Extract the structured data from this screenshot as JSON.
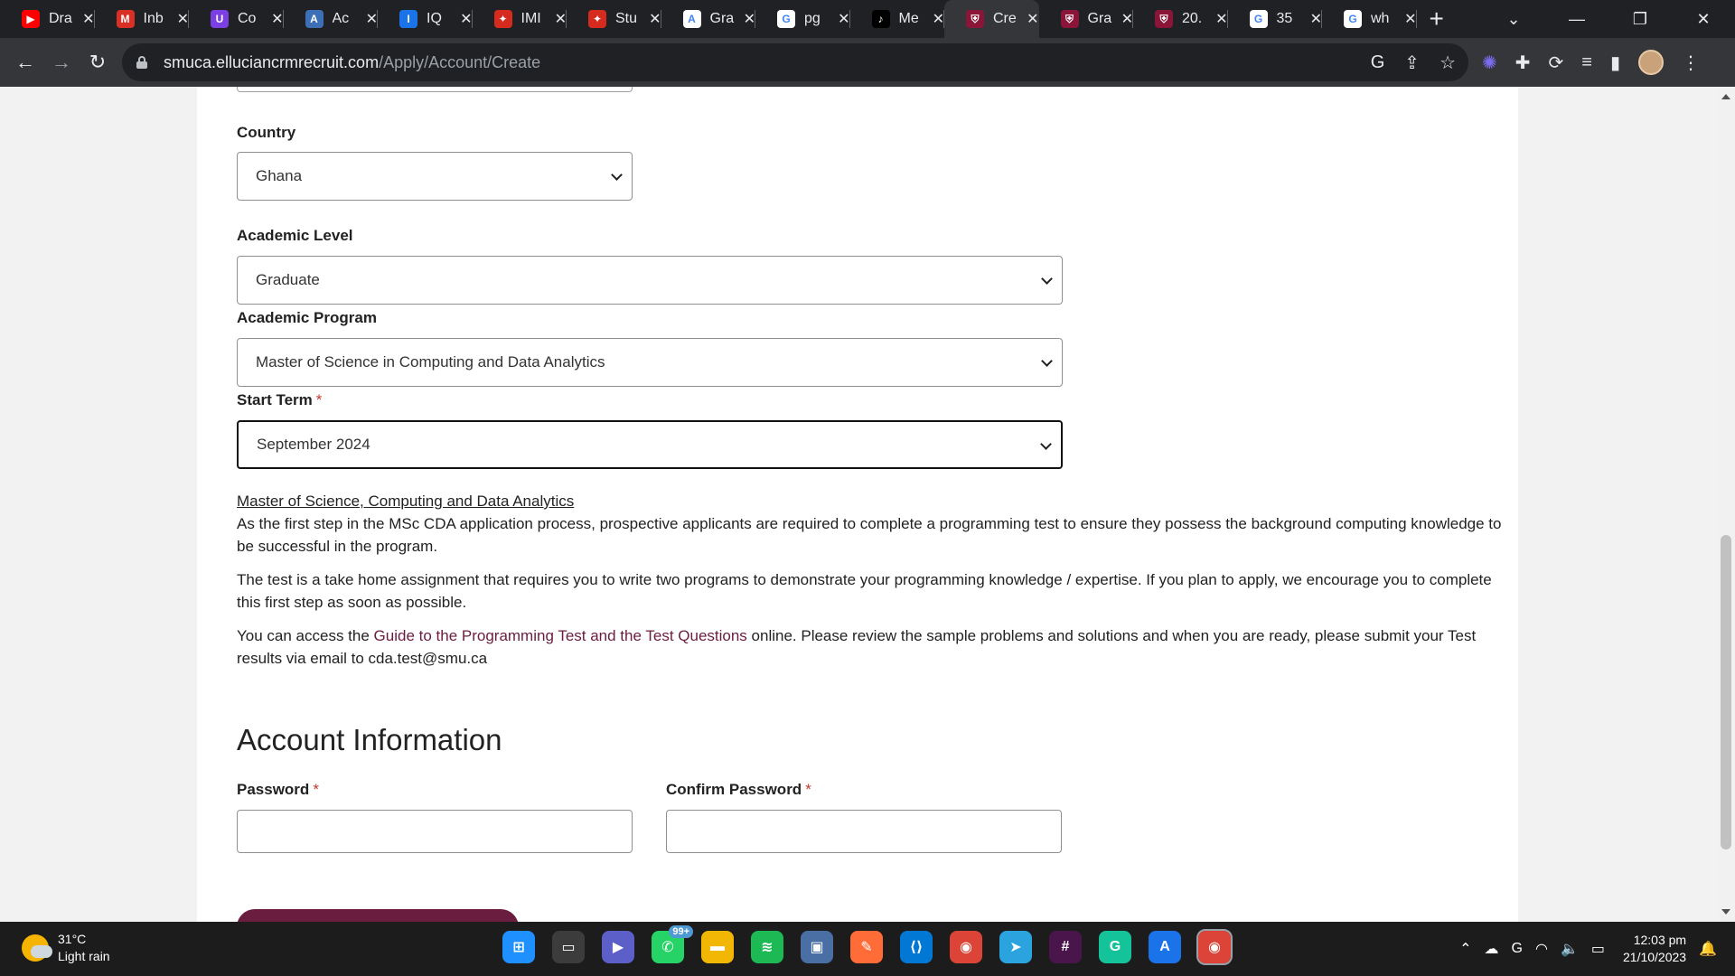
{
  "browser": {
    "tabs": [
      {
        "title": "Dra",
        "icon": "youtube-icon",
        "color": "#ff0000",
        "glyph": "▶"
      },
      {
        "title": "Inb",
        "icon": "gmail-icon",
        "color": "#d93025",
        "glyph": "M"
      },
      {
        "title": "Co",
        "icon": "app-icon",
        "color": "#7b3fe4",
        "glyph": "U"
      },
      {
        "title": "Ac",
        "icon": "doc-icon",
        "color": "#3d6fb6",
        "glyph": "A"
      },
      {
        "title": "IQ",
        "icon": "iq-icon",
        "color": "#1a73e8",
        "glyph": "I"
      },
      {
        "title": "IMI",
        "icon": "maple-leaf-icon",
        "color": "#d52b1e",
        "glyph": "✦"
      },
      {
        "title": "Stu",
        "icon": "maple-leaf-icon",
        "color": "#d52b1e",
        "glyph": "✦"
      },
      {
        "title": "Gra",
        "icon": "a-icon",
        "color": "#ffffff",
        "glyph": "A"
      },
      {
        "title": "pg",
        "icon": "google-icon",
        "color": "#ffffff",
        "glyph": "G"
      },
      {
        "title": "Me",
        "icon": "tiktok-icon",
        "color": "#000000",
        "glyph": "♪"
      },
      {
        "title": "Cre",
        "icon": "smu-crest-icon",
        "color": "#8b1538",
        "glyph": "⛨",
        "active": true
      },
      {
        "title": "Gra",
        "icon": "smu-crest-icon",
        "color": "#8b1538",
        "glyph": "⛨"
      },
      {
        "title": "20.",
        "icon": "smu-crest-icon",
        "color": "#8b1538",
        "glyph": "⛨"
      },
      {
        "title": "35",
        "icon": "google-icon",
        "color": "#ffffff",
        "glyph": "G"
      },
      {
        "title": "wh",
        "icon": "google-icon",
        "color": "#ffffff",
        "glyph": "G"
      }
    ],
    "url_host": "smuca.elluciancrmrecruit.com",
    "url_path": "/Apply/Account/Create"
  },
  "form": {
    "country": {
      "label": "Country",
      "value": "Ghana"
    },
    "academic_level": {
      "label": "Academic Level",
      "value": "Graduate"
    },
    "academic_program": {
      "label": "Academic Program",
      "value": "Master of Science in Computing and Data Analytics"
    },
    "start_term": {
      "label": "Start Term",
      "required": "*",
      "value": "September 2024"
    }
  },
  "info": {
    "heading": "Master of Science, Computing and Data Analytics",
    "p1": "As the first step in the MSc CDA application process, prospective applicants are required to complete a programming test to ensure they possess the background computing knowledge to be successful in the program.",
    "p2": "The test is a take home assignment that requires you to write two programs to demonstrate your programming knowledge / expertise. If you plan to apply, we encourage you to complete this first step as soon as possible.",
    "p3_prefix": "You can access the ",
    "p3_link": "Guide to the Programming Test and the Test Questions",
    "p3_suffix": " online. Please review the sample problems and solutions and when you are ready, please submit your Test results via email to cda.test@smu.ca"
  },
  "account": {
    "title": "Account Information",
    "password_label": "Password",
    "confirm_password_label": "Confirm Password",
    "required_mark": "*"
  },
  "taskbar": {
    "temperature": "31°C",
    "condition": "Light rain",
    "whatsapp_badge": "99+",
    "time": "12:03 pm",
    "date": "21/10/2023"
  }
}
